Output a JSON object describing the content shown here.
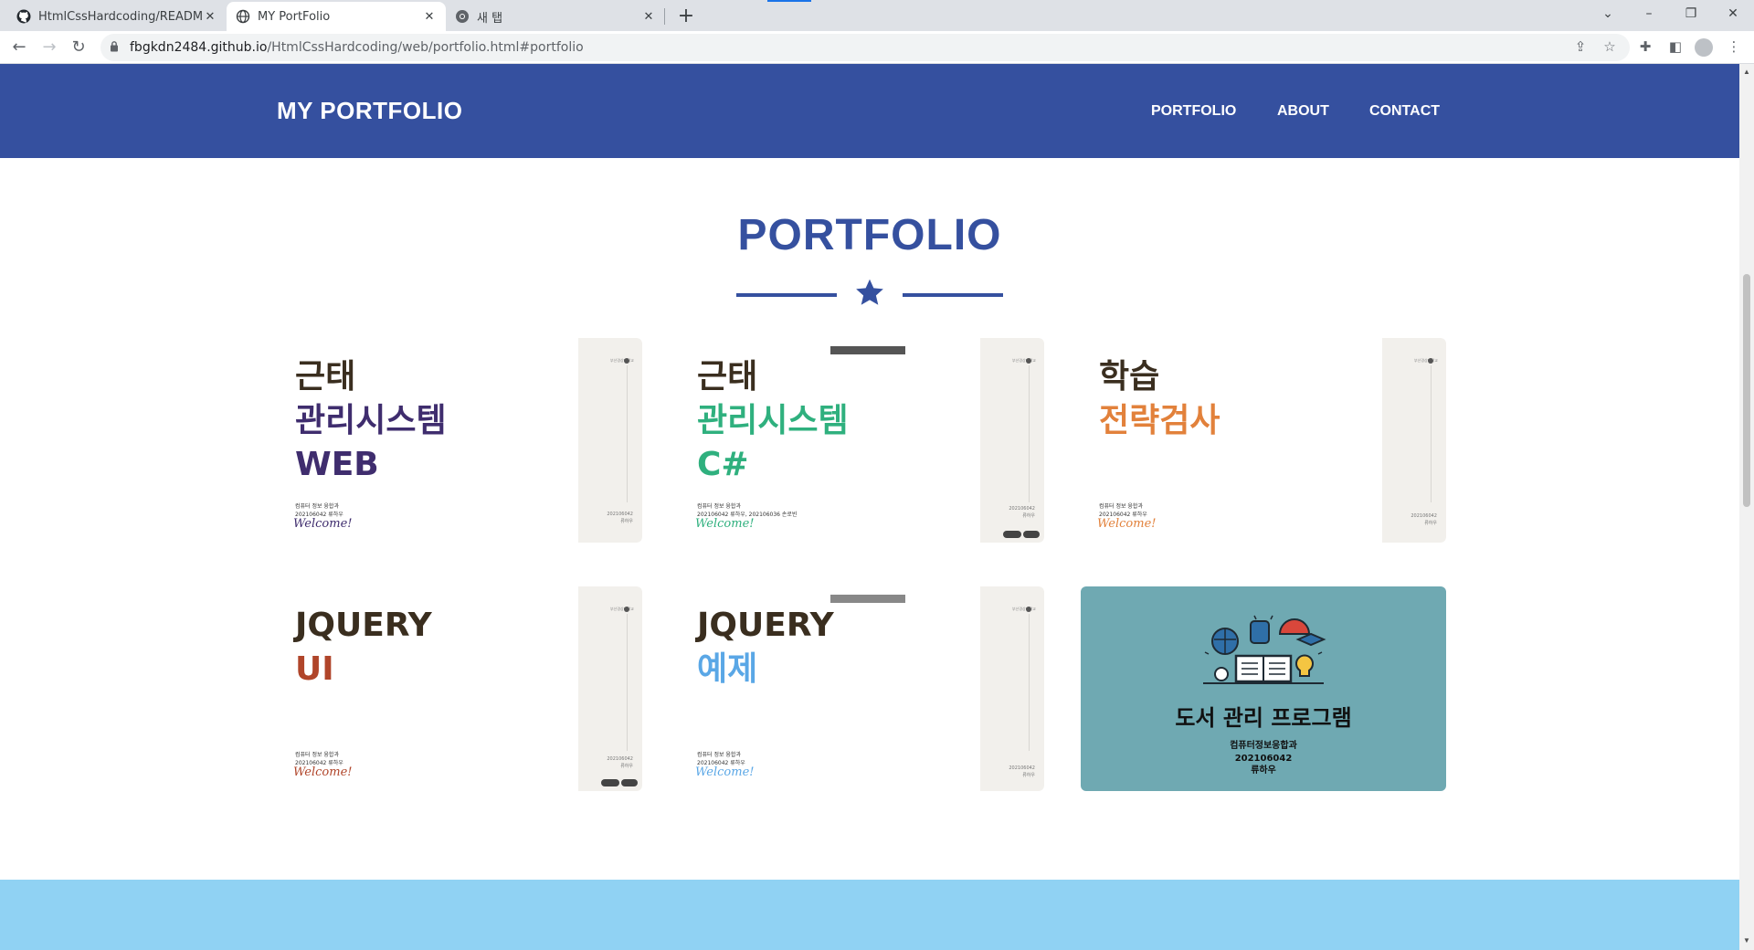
{
  "browser": {
    "tabs": [
      {
        "title": "HtmlCssHardcoding/README.m",
        "icon": "github-icon"
      },
      {
        "title": "MY PortFolio",
        "icon": "globe-icon"
      },
      {
        "title": "새 탭",
        "icon": "chrome-icon"
      }
    ],
    "new_tab_label": "+",
    "window_controls": {
      "minimize": "–",
      "maximize": "❐",
      "close": "✕",
      "tab_list": "⌄"
    },
    "url_host": "fbgkdn2484.github.io",
    "url_path": "/HtmlCssHardcoding/web/portfolio.html#portfolio"
  },
  "header": {
    "brand": "MY PORTFOLIO",
    "nav": [
      "PORTFOLIO",
      "ABOUT",
      "CONTACT"
    ],
    "background": "#35509f"
  },
  "portfolio": {
    "title": "PORTFOLIO",
    "accent": "#35509f",
    "cards": [
      {
        "line1": "근태",
        "line2": "관리시스템",
        "line3": "WEB",
        "accent": "#3f2d6e",
        "meta1": "컴퓨터 정보 융합과",
        "meta2": "202106042 류하우",
        "welcome": "Welcome!",
        "cap_top": "부산경상대학교",
        "cap_bottom1": "202106042",
        "cap_bottom2": "류하우"
      },
      {
        "line1": "근태",
        "line2": "관리시스템",
        "line3": "C#",
        "accent": "#2fb07e",
        "meta1": "컴퓨터 정보 융합과",
        "meta2": "202106042 류하우, 202106036 손로빈",
        "welcome": "Welcome!",
        "cap_top": "부산경상대학교",
        "cap_bottom1": "202106042",
        "cap_bottom2": "류하우"
      },
      {
        "line1": "학습",
        "line2": "전략검사",
        "line3": "",
        "accent": "#e2813b",
        "meta1": "컴퓨터 정보 융합과",
        "meta2": "202106042 류하우",
        "welcome": "Welcome!",
        "cap_top": "부산경상대학교",
        "cap_bottom1": "202106042",
        "cap_bottom2": "류하우"
      },
      {
        "line1": "JQUERY",
        "line2": "UI",
        "line3": "",
        "accent": "#b0452a",
        "meta1": "컴퓨터 정보 융합과",
        "meta2": "202106042 류하우",
        "welcome": "Welcome!",
        "cap_top": "부산경상대학교",
        "cap_bottom1": "202106042",
        "cap_bottom2": "류하우"
      },
      {
        "line1": "JQUERY",
        "line2": "예제",
        "line3": "",
        "accent": "#5aa7e6",
        "meta1": "컴퓨터 정보 융합과",
        "meta2": "202106042 류하우",
        "welcome": "Welcome!",
        "cap_top": "부산경상대학교",
        "cap_bottom1": "202106042",
        "cap_bottom2": "류하우"
      }
    ],
    "library": {
      "title": "도서 관리 프로그램",
      "dept": "컴퓨터정보응합과",
      "id": "202106042",
      "name": "류하우",
      "background": "#6fa9b2"
    }
  }
}
